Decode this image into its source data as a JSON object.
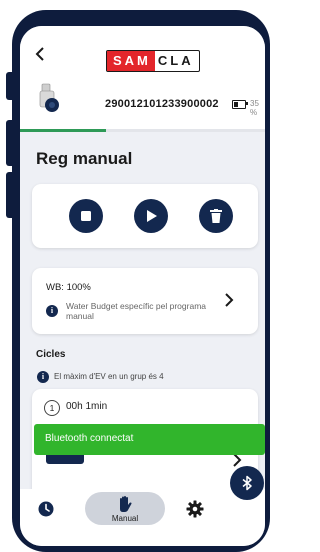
{
  "header": {
    "back_icon": "chevron-left-icon",
    "logo_red": "SAM",
    "logo_black": "CLA",
    "serial_number": "290012101233900002",
    "battery_text": "35 %",
    "battery_level": 0.35,
    "sync_progress": 0.35
  },
  "page": {
    "title": "Reg manual"
  },
  "controls": {
    "stop_icon": "stop-icon",
    "play_icon": "play-icon",
    "delete_icon": "trash-icon"
  },
  "water_budget": {
    "label": "WB: 100%",
    "description": "Water Budget específic pel programa manual"
  },
  "cycles": {
    "heading": "Cicles",
    "note": "El màxim d'EV en un grup és 4",
    "items": [
      {
        "number": "1",
        "time": "00h 1min"
      }
    ]
  },
  "toast": {
    "message": "Bluetooth connectat"
  },
  "nav": {
    "manual_label": "Manual"
  },
  "colors": {
    "brand_red": "#e3262b",
    "navy": "#13284f",
    "toast_green": "#31b52c",
    "progress_green": "#2e9a57"
  }
}
